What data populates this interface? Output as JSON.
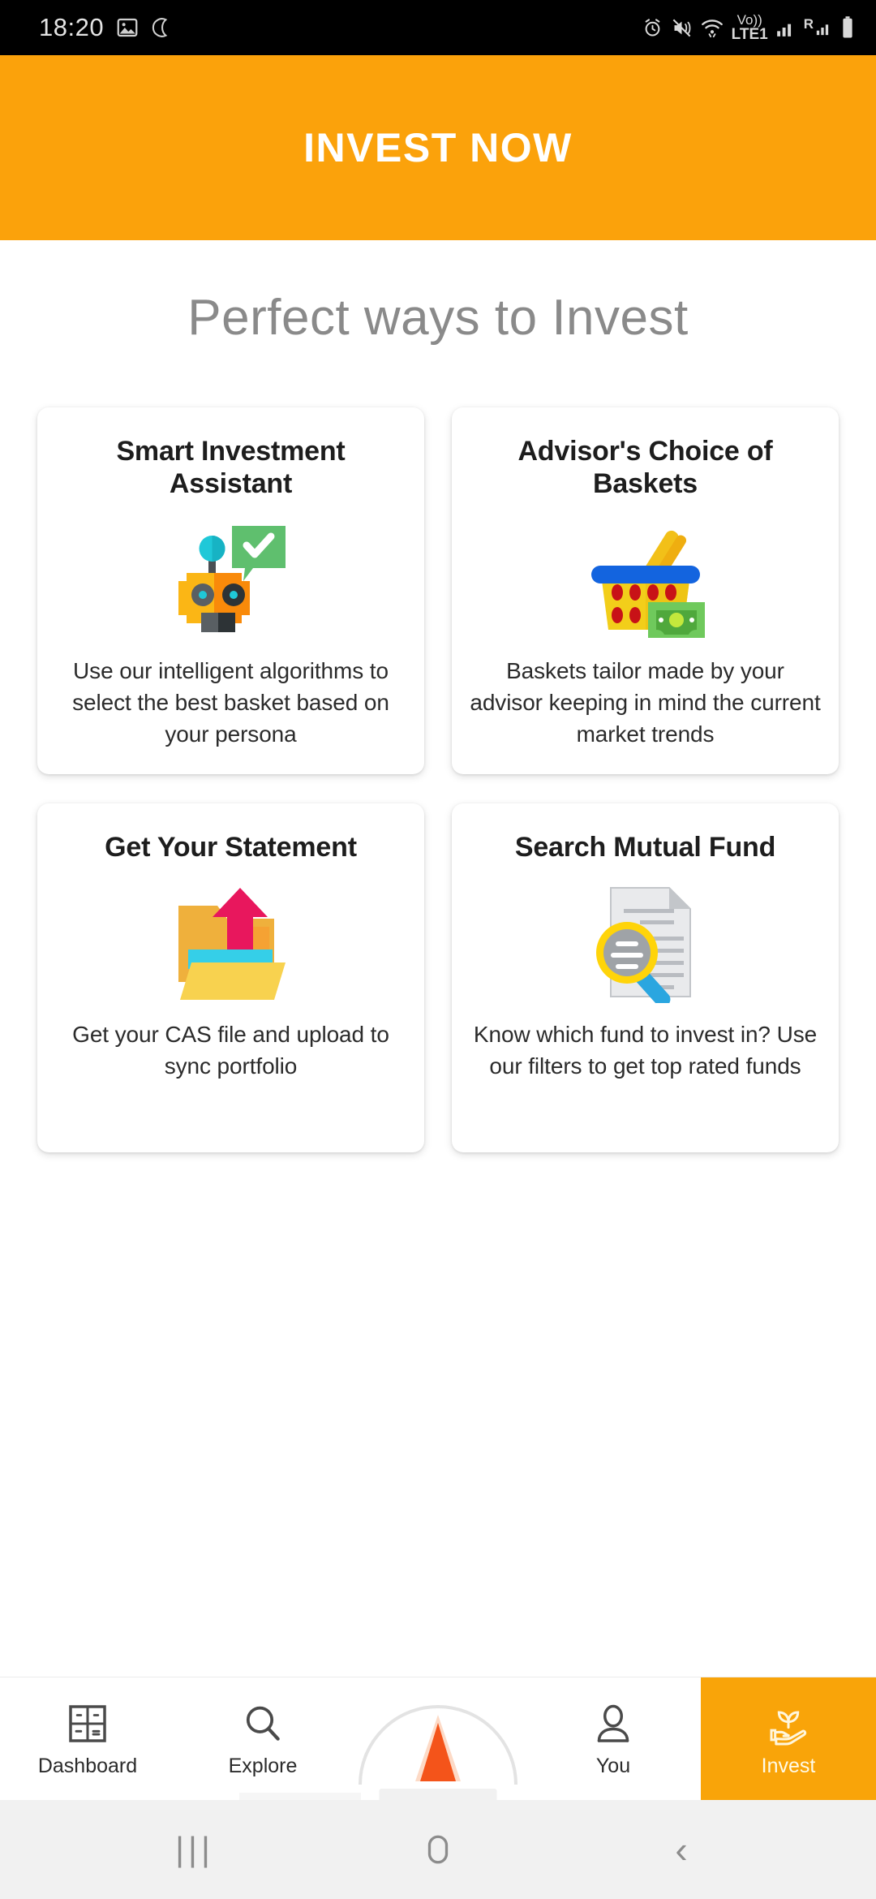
{
  "status_bar": {
    "time": "18:20",
    "left_icons": [
      "image-icon",
      "do-not-disturb-moon-icon"
    ],
    "right_icons": [
      "alarm-icon",
      "vibrate-mute-icon",
      "wifi-icon",
      "volte-icon",
      "signal-bars-icon",
      "roaming-signal-icon",
      "battery-icon"
    ],
    "network_label": "Vo))",
    "network_sub": "LTE1",
    "roaming_label": "R"
  },
  "header": {
    "title": "INVEST NOW",
    "background": "#FBA20B",
    "text_color": "#FFFFFF"
  },
  "page": {
    "title": "Perfect ways to Invest",
    "title_color": "#8A8A8A"
  },
  "cards": [
    {
      "title": "Smart Investment Assistant",
      "description": "Use our intelligent algorithms to select the best basket based on your persona",
      "icon": "robot-assistant-icon"
    },
    {
      "title": "Advisor's Choice of Baskets",
      "description": "Baskets tailor made by your advisor keeping in mind the current market trends",
      "icon": "shopping-basket-icon"
    },
    {
      "title": "Get Your Statement",
      "description": "Get your CAS file and upload to sync portfolio",
      "icon": "folder-upload-icon"
    },
    {
      "title": "Search Mutual Fund",
      "description": "Know which fund to invest in? Use our filters to get top rated funds",
      "icon": "document-search-icon"
    }
  ],
  "bottom_nav": {
    "active_color": "#F9A409",
    "items": [
      {
        "label": "Dashboard",
        "icon": "dashboard-grid-icon",
        "active": false
      },
      {
        "label": "Explore",
        "icon": "magnifier-icon",
        "active": false
      },
      {
        "label": "",
        "icon": "center-arrow-fab-icon",
        "active": false
      },
      {
        "label": "You",
        "icon": "person-icon",
        "active": false
      },
      {
        "label": "Invest",
        "icon": "hand-plant-icon",
        "active": true
      }
    ]
  },
  "android_nav": {
    "recents": "|||",
    "home": "home-icon",
    "back": "‹"
  }
}
